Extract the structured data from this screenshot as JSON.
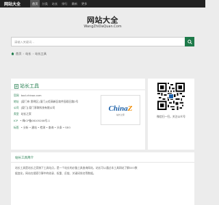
{
  "topbar": {
    "brand": "网站大全",
    "nav": [
      "首页",
      "分类",
      "站长",
      "排行",
      "最新",
      "更多"
    ],
    "active_index": 0
  },
  "header": {
    "title": "网站大全",
    "subtitle": "WangZhiDaQuan.Com"
  },
  "search": {
    "placeholder": "请输入关键词..."
  },
  "breadcrumb": {
    "home": "首页",
    "category": "站长",
    "current": "站长工具"
  },
  "site": {
    "name": "站长工具",
    "fields": [
      {
        "key": "官网",
        "value": "tool.chinaz.com"
      },
      {
        "key": "地址",
        "value": "[厦门市 思明区] 厦门火炬高新区软件园观日路2号"
      },
      {
        "key": "公司",
        "value": "[厦门] 厦门享联科技有限公司"
      },
      {
        "key": "类型",
        "value": "站长之家"
      },
      {
        "key": "ICP",
        "value": "• 闽ICP备08105208号-1"
      },
      {
        "key": "标签",
        "value": "• 分析 • 建站 • 检测 • 查询 • 头条 • SEO"
      }
    ],
    "logo_text": "China",
    "logo_accent": "Z",
    "logo_tail": ".com",
    "logo_sub": "站长之家"
  },
  "qr": {
    "caption": "微信扫一扫，关注公众号"
  },
  "intro": {
    "title": "站长工具简介",
    "text": "站长工具是站长之家旗下工具站点，是一个站长的必备工具查询网站，站长可以通过本工具网站了解SEO数据变化，网站在搜索引擎中的收录、权重、反链、关键词排名等数据。"
  },
  "colors": {
    "accent": "#1e7a4a",
    "topbar": "#222222",
    "background": "#ececec"
  }
}
